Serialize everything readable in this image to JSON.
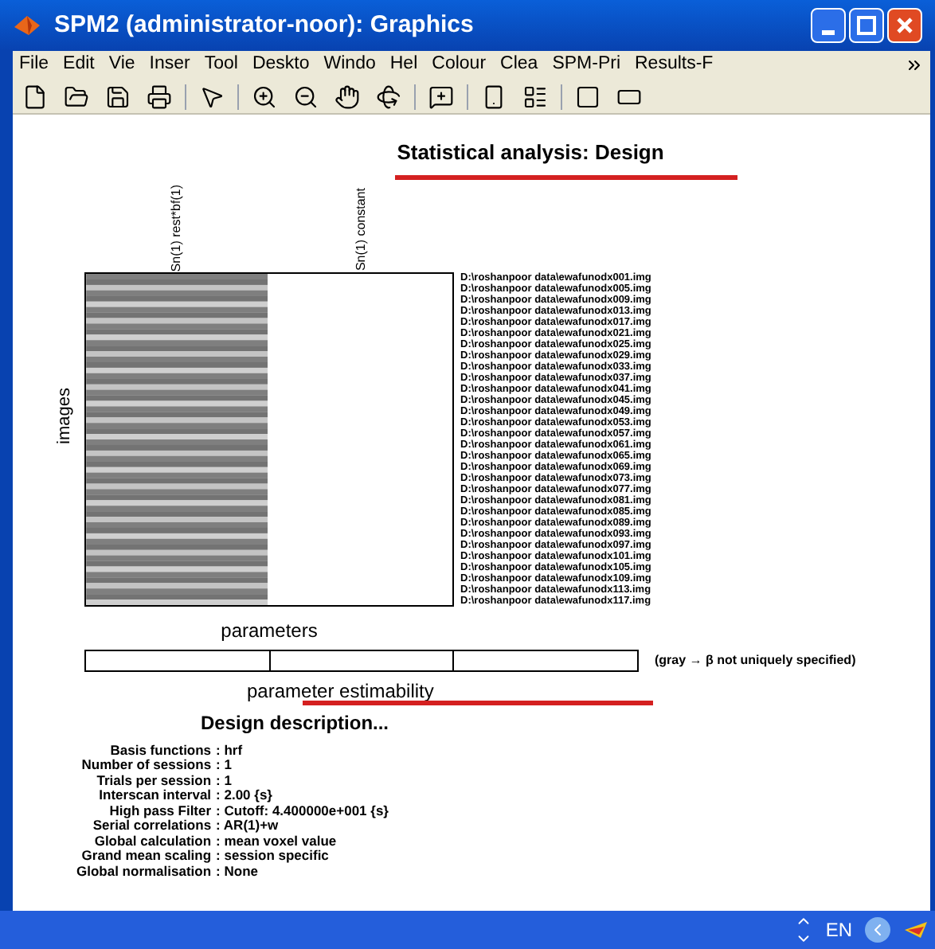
{
  "window": {
    "title": "SPM2 (administrator-noor): Graphics"
  },
  "menu": [
    "File",
    "Edit",
    "Vie",
    "Inser",
    "Tool",
    "Deskto",
    "Windo",
    "Hel",
    "Colour",
    "Clea",
    "SPM-Pri",
    "Results-F"
  ],
  "figure": {
    "title": "Statistical analysis: Design",
    "column_labels": [
      "Sn(1) rest*bf(1)",
      "Sn(1) constant"
    ],
    "ylabel": "images",
    "xlabel": "parameters",
    "row_labels": [
      "D:\\roshanpoor data\\ewafunodx001.img",
      "D:\\roshanpoor data\\ewafunodx005.img",
      "D:\\roshanpoor data\\ewafunodx009.img",
      "D:\\roshanpoor data\\ewafunodx013.img",
      "D:\\roshanpoor data\\ewafunodx017.img",
      "D:\\roshanpoor data\\ewafunodx021.img",
      "D:\\roshanpoor data\\ewafunodx025.img",
      "D:\\roshanpoor data\\ewafunodx029.img",
      "D:\\roshanpoor data\\ewafunodx033.img",
      "D:\\roshanpoor data\\ewafunodx037.img",
      "D:\\roshanpoor data\\ewafunodx041.img",
      "D:\\roshanpoor data\\ewafunodx045.img",
      "D:\\roshanpoor data\\ewafunodx049.img",
      "D:\\roshanpoor data\\ewafunodx053.img",
      "D:\\roshanpoor data\\ewafunodx057.img",
      "D:\\roshanpoor data\\ewafunodx061.img",
      "D:\\roshanpoor data\\ewafunodx065.img",
      "D:\\roshanpoor data\\ewafunodx069.img",
      "D:\\roshanpoor data\\ewafunodx073.img",
      "D:\\roshanpoor data\\ewafunodx077.img",
      "D:\\roshanpoor data\\ewafunodx081.img",
      "D:\\roshanpoor data\\ewafunodx085.img",
      "D:\\roshanpoor data\\ewafunodx089.img",
      "D:\\roshanpoor data\\ewafunodx093.img",
      "D:\\roshanpoor data\\ewafunodx097.img",
      "D:\\roshanpoor data\\ewafunodx101.img",
      "D:\\roshanpoor data\\ewafunodx105.img",
      "D:\\roshanpoor data\\ewafunodx109.img",
      "D:\\roshanpoor data\\ewafunodx113.img",
      "D:\\roshanpoor data\\ewafunodx117.img"
    ],
    "estimability_note": "(gray → β not uniquely specified)",
    "estimability_label": "parameter estimability",
    "description_title": "Design description...",
    "description": [
      {
        "label": "Basis functions",
        "value": ": hrf"
      },
      {
        "label": "Number of sessions",
        "value": ": 1"
      },
      {
        "label": "Trials per session",
        "value": ": 1"
      },
      {
        "label": "Interscan interval",
        "value": ": 2.00 {s}"
      },
      {
        "label": "High pass Filter",
        "value": ": Cutoff: 4.400000e+001 {s}"
      },
      {
        "label": "Serial correlations",
        "value": ": AR(1)+w"
      },
      {
        "label": "Global calculation",
        "value": ": mean voxel value"
      },
      {
        "label": "Grand mean scaling",
        "value": ": session specific"
      },
      {
        "label": "Global normalisation",
        "value": ": None"
      }
    ]
  },
  "taskbar": {
    "language": "EN"
  }
}
